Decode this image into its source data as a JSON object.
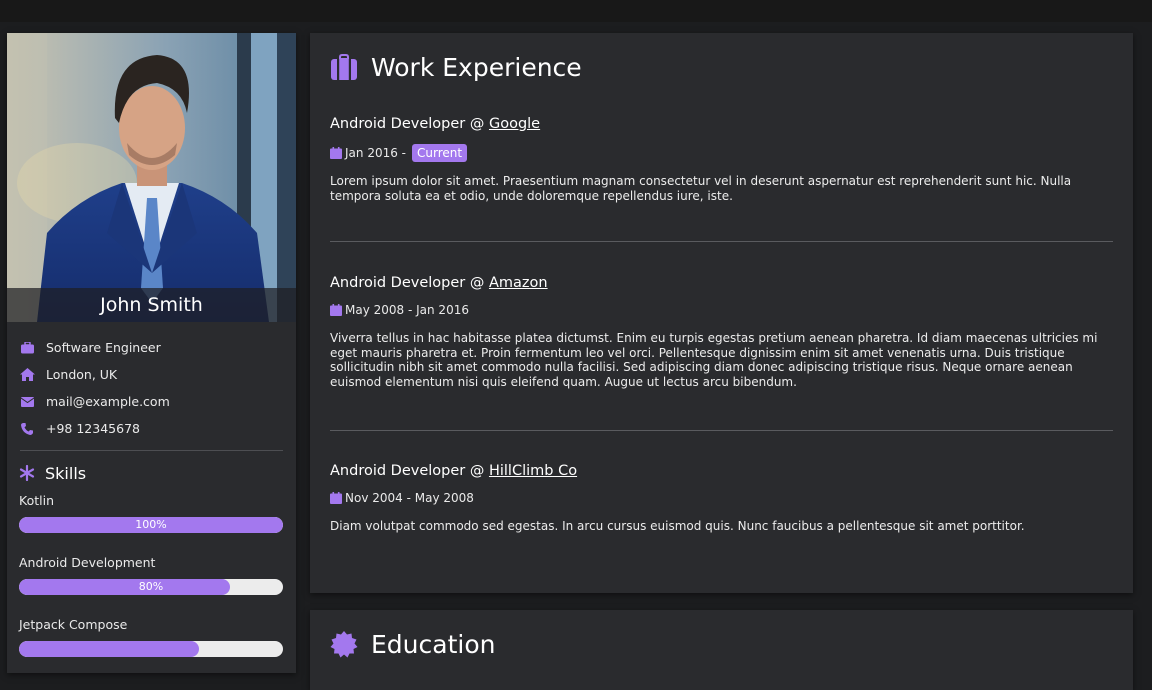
{
  "colors": {
    "accent": "#a378ee",
    "card": "#2a2b2e",
    "background": "#1c1d1f"
  },
  "profile": {
    "name": "John Smith",
    "role": "Software Engineer",
    "location": "London, UK",
    "email": "mail@example.com",
    "phone": "+98 12345678",
    "icons": [
      "briefcase-icon",
      "home-icon",
      "envelope-icon",
      "phone-icon"
    ]
  },
  "skills": {
    "title": "Skills",
    "icon": "asterisk-icon",
    "items": [
      {
        "name": "Kotlin",
        "level": 100,
        "label": "100%"
      },
      {
        "name": "Android Development",
        "level": 80,
        "label": "80%"
      },
      {
        "name": "Jetpack Compose",
        "level": 68,
        "label": ""
      }
    ]
  },
  "work": {
    "title": "Work Experience",
    "icon": "suitcase-icon",
    "jobs": [
      {
        "role": "Android Developer @ ",
        "company": "Google",
        "date": "Jan 2016 -",
        "badge": "Current",
        "description": "Lorem ipsum dolor sit amet. Praesentium magnam consectetur vel in deserunt aspernatur est reprehenderit sunt hic. Nulla tempora soluta ea et odio, unde doloremque repellendus iure, iste."
      },
      {
        "role": "Android Developer @ ",
        "company": "Amazon",
        "date": "May 2008 - Jan 2016",
        "description": "Viverra tellus in hac habitasse platea dictumst. Enim eu turpis egestas pretium aenean pharetra. Id diam maecenas ultricies mi eget mauris pharetra et. Proin fermentum leo vel orci. Pellentesque dignissim enim sit amet venenatis urna. Duis tristique sollicitudin nibh sit amet commodo nulla facilisi. Sed adipiscing diam donec adipiscing tristique risus. Neque ornare aenean euismod elementum nisi quis eleifend quam. Augue ut lectus arcu bibendum."
      },
      {
        "role": "Android Developer @ ",
        "company": "HillClimb Co",
        "date": "Nov 2004 - May 2008",
        "description": "Diam volutpat commodo sed egestas. In arcu cursus euismod quis. Nunc faucibus a pellentesque sit amet porttitor."
      }
    ]
  },
  "education": {
    "title": "Education",
    "icon": "certificate-icon"
  }
}
